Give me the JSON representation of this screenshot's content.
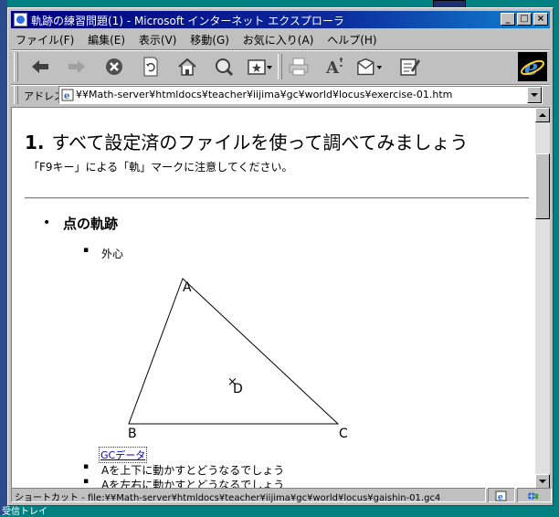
{
  "window": {
    "title": "軌跡の練習問題(1) - Microsoft インターネット エクスプローラ",
    "controls": {
      "minimize": "_",
      "maximize": "□",
      "close": "×"
    }
  },
  "menu": [
    "ファイル(F)",
    "編集(E)",
    "表示(V)",
    "移動(G)",
    "お気に入り(A)",
    "ヘルプ(H)"
  ],
  "toolbar": [
    "back-icon",
    "forward-icon",
    "stop-icon",
    "refresh-icon",
    "home-icon",
    "search-icon",
    "favorites-icon",
    "print-icon",
    "font-icon",
    "mail-icon",
    "edit-icon"
  ],
  "address": {
    "label": "アドレス",
    "url": "¥¥Math-server¥htmldocs¥teacher¥iijima¥gc¥world¥locus¥exercise-01.htm"
  },
  "page": {
    "heading_number": "1.",
    "heading": "すべて設定済のファイルを使って調べてみましょう",
    "note": "「F9キー」による「軌」マークに注意してください。",
    "section_title": "点の軌跡",
    "first_item": "外心",
    "figure": {
      "labels": {
        "a": "A",
        "b": "B",
        "c": "C",
        "d": "D"
      },
      "marker": "×"
    },
    "link": "GCデータ",
    "steps": [
      "Aを上下に動かすとどうなるでしょう",
      "Aを左右に動かすとどうなるでしょう"
    ]
  },
  "status": {
    "text": "ショートカット - file:¥¥Math-server¥htmldocs¥teacher¥iijima¥gc¥world¥locus¥gaishin-01.gc4"
  },
  "desktop": {
    "label": "受信トレイ"
  }
}
